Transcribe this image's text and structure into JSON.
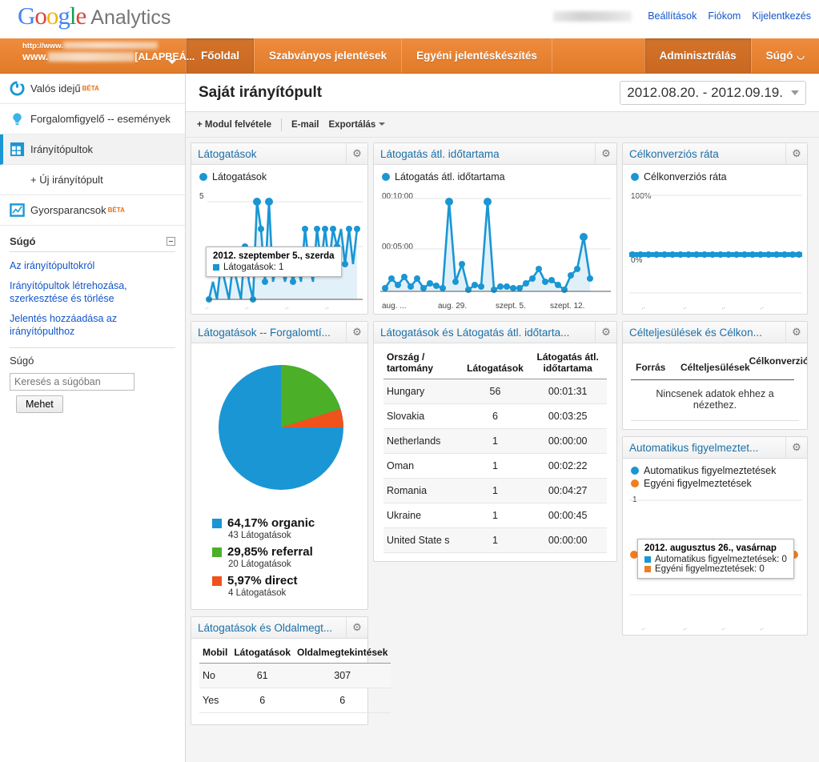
{
  "brand": {
    "logo_google": "Google",
    "logo_product": "Analytics"
  },
  "account_links": [
    {
      "label": "Beállítások"
    },
    {
      "label": "Fiókom"
    },
    {
      "label": "Kijelentkezés"
    }
  ],
  "account_picker": {
    "url_prefix": "http://www.",
    "name_prefix": "www.",
    "profile_suffix": "[ALAPBEÁ..."
  },
  "nav": {
    "tabs": [
      {
        "label": "Főoldal",
        "active": true
      },
      {
        "label": "Szabványos jelentések",
        "active": false
      },
      {
        "label": "Egyéni jelentéskészítés",
        "active": false
      }
    ],
    "right_tabs": [
      {
        "label": "Adminisztrálás",
        "active": true
      },
      {
        "label": "Súgó",
        "external": true,
        "external_icon": "external-link-icon"
      }
    ]
  },
  "sidebar": {
    "items": [
      {
        "label": "Valós idejű",
        "badge": "BÉTA",
        "icon": "realtime-icon",
        "selected": false
      },
      {
        "label": "Forgalomfigyelő -- események",
        "badge": "",
        "icon": "lightbulb-icon",
        "selected": false
      },
      {
        "label": "Irányítópultok",
        "badge": "",
        "icon": "dashboard-grid-icon",
        "selected": true
      }
    ],
    "sub_item": {
      "label": "+ Új irányítópult"
    },
    "shortcuts": {
      "label": "Gyorsparancsok",
      "badge": "BÉTA",
      "icon": "shortcuts-icon"
    },
    "help": {
      "heading": "Súgó",
      "collapse_icon": "collapse-icon",
      "links": [
        "Az irányítópultokról",
        "Irányítópultok létrehozása, szerkesztése és törlése",
        "Jelentés hozzáadása az irányítópulthoz"
      ],
      "search_heading": "Súgó",
      "search_placeholder": "Keresés a súgóban",
      "search_value": "",
      "go_button": "Mehet"
    }
  },
  "main": {
    "page_title": "Saját irányítópult",
    "date_range": "2012.08.20. - 2012.09.19.",
    "toolbar": {
      "add_module": "+ Modul felvétele",
      "email": "E-mail",
      "export": "Exportálás"
    }
  },
  "widgets": {
    "visits": {
      "title": "Látogatások",
      "gear_icon": "gear-icon",
      "legend": "Látogatások",
      "y_top": "5",
      "tooltip": {
        "date": "2012. szeptember 5., szerda",
        "metric": "Látogatások: 1"
      }
    },
    "avg_duration": {
      "title": "Látogatás átl. időtartama",
      "gear_icon": "gear-icon",
      "legend": "Látogatás átl. időtartama",
      "y_top": "00:10:00",
      "y_mid": "00:05:00",
      "x_ticks": [
        "aug. ...",
        "aug. 29.",
        "szept. 5.",
        "szept. 12."
      ]
    },
    "goal_rate": {
      "title": "Célkonverziós ráta",
      "gear_icon": "gear-icon",
      "legend": "Célkonverziós ráta",
      "y_top": "100%",
      "y_zero": "0%"
    },
    "traffic_pie": {
      "title": "Látogatások -- Forgalomtí...",
      "gear_icon": "gear-icon"
    },
    "country_table": {
      "title": "Látogatások és Látogatás átl. időtarta...",
      "gear_icon": "gear-icon",
      "columns": [
        "Ország / tartomány",
        "Látogatások",
        "Látogatás átl. időtartama"
      ],
      "rows": [
        [
          "Hungary",
          "56",
          "00:01:31"
        ],
        [
          "Slovakia",
          "6",
          "00:03:25"
        ],
        [
          "Netherlands",
          "1",
          "00:00:00"
        ],
        [
          "Oman",
          "1",
          "00:02:22"
        ],
        [
          "Romania",
          "1",
          "00:04:27"
        ],
        [
          "Ukraine",
          "1",
          "00:00:45"
        ],
        [
          "United State s",
          "1",
          "00:00:00"
        ]
      ]
    },
    "goals_table": {
      "title": "Célteljesülések és Célkon...",
      "gear_icon": "gear-icon",
      "columns": [
        "Forrás",
        "Célteljesülések",
        "Célkonverziós ráta"
      ],
      "empty_message": "Nincsenek adatok ehhez a nézethez."
    },
    "alerts": {
      "title": "Automatikus figyelmeztet...",
      "gear_icon": "gear-icon",
      "legend": [
        {
          "label": "Automatikus figyelmeztetések",
          "color": "#1a96d4"
        },
        {
          "label": "Egyéni figyelmeztetések",
          "color": "#f07d20"
        }
      ],
      "y_top": "1",
      "tooltip": {
        "date": "2012. augusztus 26., vasárnap",
        "row1": "Automatikus figyelmeztetések: 0",
        "row2": "Egyéni figyelmeztetések: 0"
      }
    },
    "mobile_table": {
      "title": "Látogatások és Oldalmegt...",
      "gear_icon": "gear-icon",
      "columns": [
        "Mobil",
        "Látogatások",
        "Oldalmegtekintések"
      ],
      "rows": [
        [
          "No",
          "61",
          "307"
        ],
        [
          "Yes",
          "6",
          "6"
        ]
      ]
    }
  },
  "colors": {
    "accent_blue": "#1a96d4",
    "accent_orange": "#f07d20",
    "pie_green": "#4caf28",
    "nav_orange": "#e8832f",
    "link_blue": "#1155CC"
  },
  "chart_data": [
    {
      "type": "line",
      "name": "visits",
      "title": "Látogatások",
      "ylabel": "",
      "xlabel": "",
      "ylim": [
        0,
        5
      ],
      "yticks": [
        "5"
      ],
      "legend": [
        "Látogatások"
      ],
      "grid": true,
      "legend_position": "top-left",
      "values": [
        1,
        0,
        2,
        1,
        3,
        1,
        2,
        0,
        1,
        2,
        1,
        0,
        5,
        4,
        1,
        5,
        1,
        1,
        2,
        1,
        2,
        1,
        2,
        1,
        4,
        2,
        1,
        4,
        1,
        4,
        1,
        4,
        3,
        4
      ],
      "annotation": {
        "date": "2012. szeptember 5., szerda",
        "value": 1
      }
    },
    {
      "type": "line",
      "name": "avg_visit_duration",
      "title": "Látogatás átl. időtartama",
      "ylabel": "",
      "xlabel": "",
      "ylim": [
        0,
        12
      ],
      "yticks": [
        "00:05:00",
        "00:10:00"
      ],
      "xticks": [
        "aug. ...",
        "aug. 29.",
        "szept. 5.",
        "szept. 12."
      ],
      "legend": [
        "Látogatás átl. időtartama"
      ],
      "grid": true,
      "legend_position": "top-left",
      "values": [
        0.2,
        1.5,
        0.4,
        1.2,
        0.3,
        1.3,
        0.2,
        0.6,
        0.4,
        0.2,
        9.6,
        0.8,
        3.0,
        0.1,
        0.4,
        0.3,
        9.6,
        0.1,
        0.3,
        0.3,
        0.2,
        0.2,
        0.5,
        0.9,
        2.2,
        0.6,
        0.8,
        0.4,
        0.1,
        1.8,
        2.5,
        5.0,
        1.0
      ]
    },
    {
      "type": "line",
      "name": "goal_conversion_rate",
      "title": "Célkonverziós ráta",
      "ylabel": "",
      "xlabel": "",
      "ylim": [
        0,
        100
      ],
      "yticks": [
        "0%",
        "100%"
      ],
      "legend": [
        "Célkonverziós ráta"
      ],
      "grid": true,
      "legend_position": "top-left",
      "values": [
        0,
        0,
        0,
        0,
        0,
        0,
        0,
        0,
        0,
        0,
        0,
        0,
        0,
        0,
        0,
        0,
        0,
        0,
        0,
        0,
        0,
        0,
        0,
        0,
        0,
        0,
        0,
        0,
        0,
        0,
        0
      ]
    },
    {
      "type": "pie",
      "name": "traffic_sources",
      "title": "Látogatások -- Forgalomtí...",
      "labels": [
        "organic",
        "referral",
        "direct"
      ],
      "percent_labels": [
        "64,17% organic",
        "29,85% referral",
        "5,97% direct"
      ],
      "values": [
        64.17,
        29.85,
        5.97
      ],
      "counts": [
        "43 Látogatások",
        "20 Látogatások",
        "4 Látogatások"
      ],
      "colors": [
        "#1a96d4",
        "#4caf28",
        "#f0521c"
      ],
      "legend_position": "bottom"
    },
    {
      "type": "table",
      "name": "country_table",
      "title": "Látogatások és Látogatás átl. időtarta...",
      "columns": [
        "Ország / tartomány",
        "Látogatások",
        "Látogatás átl. időtartama"
      ],
      "rows": [
        [
          "Hungary",
          "56",
          "00:01:31"
        ],
        [
          "Slovakia",
          "6",
          "00:03:25"
        ],
        [
          "Netherlands",
          "1",
          "00:00:00"
        ],
        [
          "Oman",
          "1",
          "00:02:22"
        ],
        [
          "Romania",
          "1",
          "00:04:27"
        ],
        [
          "Ukraine",
          "1",
          "00:00:45"
        ],
        [
          "United State s",
          "1",
          "00:00:00"
        ]
      ]
    },
    {
      "type": "line",
      "name": "alerts",
      "title": "Automatikus figyelmeztet...",
      "ylim": [
        0,
        1
      ],
      "yticks": [
        "1"
      ],
      "legend": [
        "Automatikus figyelmeztetések",
        "Egyéni figyelmeztetések"
      ],
      "series": [
        {
          "name": "Automatikus figyelmeztetések",
          "values": [
            0,
            0,
            0,
            0,
            0,
            0,
            0,
            0,
            0,
            0,
            0,
            0,
            0,
            0,
            0,
            0,
            0,
            0,
            0,
            0,
            0,
            0,
            0,
            0,
            0,
            0,
            0,
            0,
            0,
            0,
            0
          ]
        },
        {
          "name": "Egyéni figyelmeztetések",
          "values": [
            0,
            0,
            0,
            0,
            0,
            0,
            0,
            0,
            0,
            0,
            0,
            0,
            0,
            0,
            0,
            0,
            0,
            0,
            0,
            0,
            0,
            0,
            0,
            0,
            0,
            0,
            0,
            0,
            0,
            0,
            0
          ]
        }
      ],
      "annotation": {
        "date": "2012. augusztus 26., vasárnap",
        "row1": "Automatikus figyelmeztetések: 0",
        "row2": "Egyéni figyelmeztetések: 0"
      }
    },
    {
      "type": "table",
      "name": "mobile_table",
      "title": "Látogatások és Oldalmegt...",
      "columns": [
        "Mobil",
        "Látogatások",
        "Oldalmegtekintések"
      ],
      "rows": [
        [
          "No",
          "61",
          "307"
        ],
        [
          "Yes",
          "6",
          "6"
        ]
      ]
    }
  ]
}
